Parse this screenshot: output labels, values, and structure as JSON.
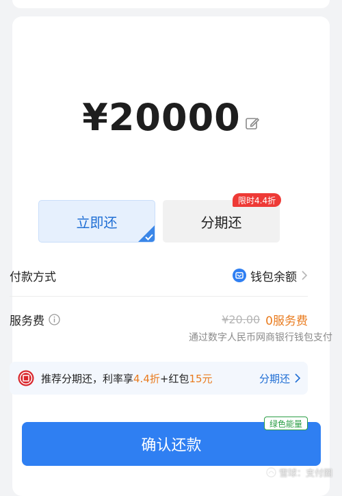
{
  "amount": {
    "currency_symbol": "¥",
    "value": "20000"
  },
  "repay_modes": {
    "now_label": "立即还",
    "installment_label": "分期还",
    "installment_badge": "限时4.4折",
    "selected": "now"
  },
  "payment_method": {
    "label": "付款方式",
    "value": "钱包余额"
  },
  "service_fee": {
    "label": "服务费",
    "original": "¥20.00",
    "current": "0服务费",
    "note": "通过数字人民币网商银行钱包支付"
  },
  "promo": {
    "prefix": "推荐分期还，利率享",
    "discount": "4.4折",
    "middle": "+红包",
    "redpacket": "15元",
    "action": "分期还"
  },
  "confirm": {
    "label": "确认还款",
    "badge": "绿色能量"
  },
  "watermark": {
    "text": "雪球：支付圈"
  },
  "colors": {
    "primary_blue": "#2f7ff2",
    "accent_orange": "#e97b1e",
    "badge_red": "#ee3a36",
    "green": "#2a9d44"
  }
}
